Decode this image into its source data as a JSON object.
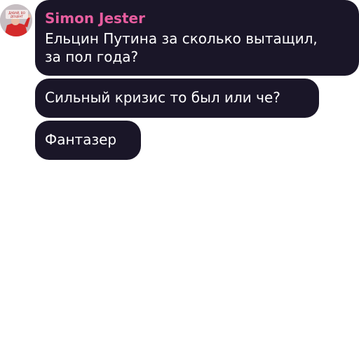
{
  "avatar": {
    "icon": "user-photo-icon",
    "caption_line1": "ДАВАЙ, ВО",
    "caption_line2": "ДОЦЕНТ"
  },
  "messages": [
    {
      "sender": "Simon Jester",
      "text": "Ельцин Путина за сколько вытащил,\nза пол года?"
    },
    {
      "text": "Сильный кризис то был или че?"
    },
    {
      "text": "Фантазер"
    }
  ],
  "colors": {
    "bubble": "#1a1628",
    "sender": "#e85d9f",
    "text": "#ffffff",
    "background": "#ffffff"
  }
}
